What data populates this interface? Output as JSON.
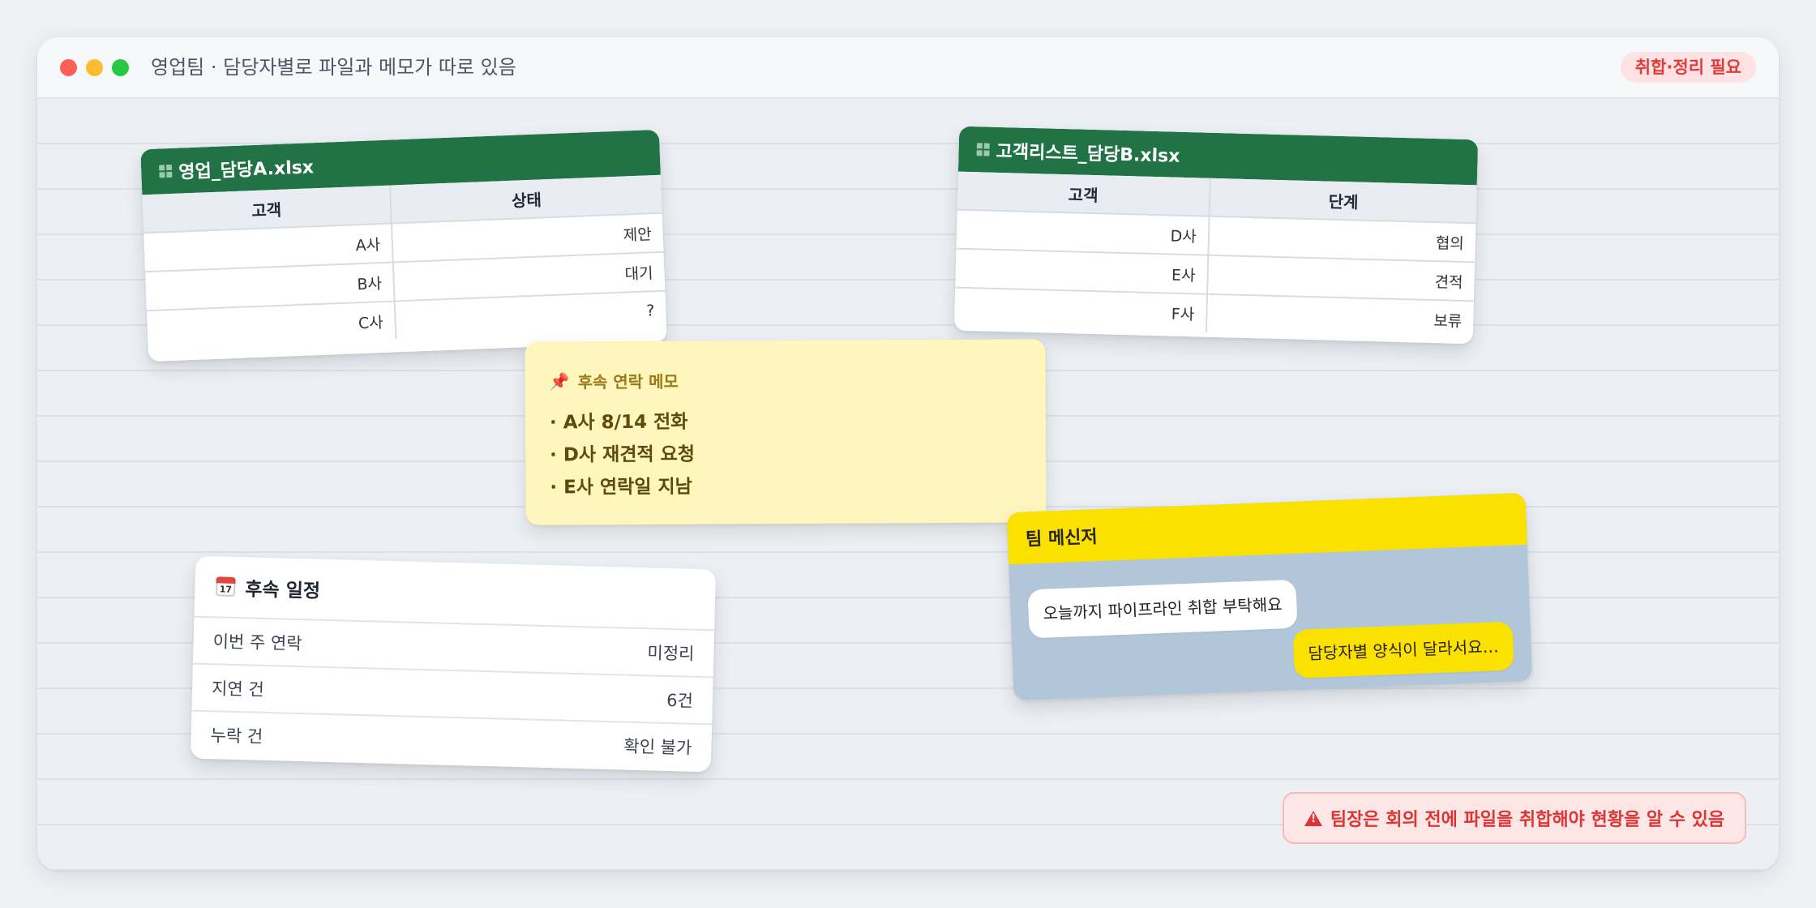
{
  "window": {
    "title": "영업팀 · 담당자별로 파일과 메모가 따로 있음",
    "badge": "취합·정리 필요"
  },
  "sheet_a": {
    "filename": "영업_담당A.xlsx",
    "columns": [
      "고객",
      "상태"
    ],
    "rows": [
      [
        "A사",
        "제안"
      ],
      [
        "B사",
        "대기"
      ],
      [
        "C사",
        "?"
      ]
    ]
  },
  "sheet_b": {
    "filename": "고객리스트_담당B.xlsx",
    "columns": [
      "고객",
      "단계"
    ],
    "rows": [
      [
        "D사",
        "협의"
      ],
      [
        "E사",
        "견적"
      ],
      [
        "F사",
        "보류"
      ]
    ]
  },
  "memo": {
    "title": "후속 연락 메모",
    "icon": "pushpin-icon",
    "lines": [
      "· A사 8/14 전화",
      "· D사 재견적 요청",
      "· E사 연락일 지남"
    ]
  },
  "schedule": {
    "title": "후속 일정",
    "icon": "calendar-icon",
    "icon_text": "17",
    "rows": [
      {
        "label": "이번 주 연락",
        "value": "미정리"
      },
      {
        "label": "지연 건",
        "value": "6건"
      },
      {
        "label": "누락 건",
        "value": "확인 불가"
      }
    ]
  },
  "messenger": {
    "title": "팀 메신저",
    "messages": [
      {
        "side": "left",
        "text": "오늘까지 파이프라인 취합 부탁해요"
      },
      {
        "side": "right",
        "text": "담당자별 양식이 달라서요…"
      }
    ]
  },
  "warning": {
    "text": "팀장은 회의 전에 파일을 취합해야 현황을 알 수 있음",
    "icon": "warning-icon"
  },
  "colors": {
    "excel_green": "#217346",
    "messenger_yellow": "#fae100",
    "alert_red": "#dd3535",
    "memo_yellow": "#fef6bd"
  }
}
